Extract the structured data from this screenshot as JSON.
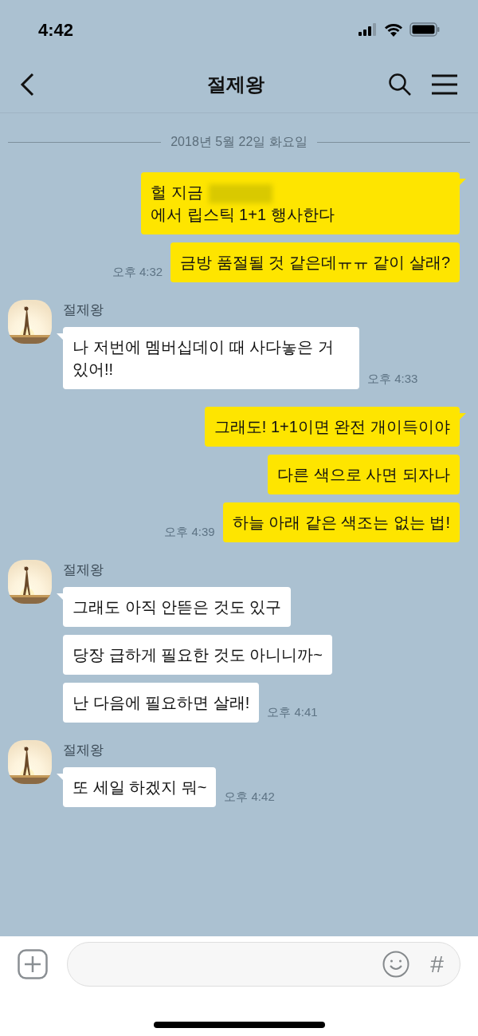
{
  "status_bar": {
    "time": "4:42"
  },
  "header": {
    "title": "절제왕"
  },
  "date_divider": "2018년 5월 22일 화요일",
  "groups": [
    {
      "kind": "sent",
      "time": "오후 4:32",
      "messages": [
        {
          "segments": [
            {
              "kind": "text",
              "text": "헐 지금"
            },
            {
              "kind": "redacted"
            },
            {
              "kind": "text",
              "text": "에서 립스틱 1+1"
            },
            {
              "kind": "text",
              "text": "행사한다"
            }
          ]
        },
        {
          "segments": [
            {
              "kind": "text",
              "text": "금방 품절될 것 같은데ㅠㅠ 같이 살래?"
            }
          ]
        }
      ]
    },
    {
      "kind": "received",
      "sender": "절제왕",
      "time": "오후 4:33",
      "messages": [
        {
          "segments": [
            {
              "kind": "text",
              "text": "나 저번에 멤버십데이 때 사다놓은 거 있어!!"
            }
          ]
        }
      ]
    },
    {
      "kind": "sent",
      "time": "오후 4:39",
      "messages": [
        {
          "segments": [
            {
              "kind": "text",
              "text": "그래도! 1+1이면 완전 개이득이야"
            }
          ]
        },
        {
          "segments": [
            {
              "kind": "text",
              "text": "다른 색으로 사면 되자나"
            }
          ]
        },
        {
          "segments": [
            {
              "kind": "text",
              "text": "하늘 아래 같은 색조는 없는 법!"
            }
          ]
        }
      ]
    },
    {
      "kind": "received",
      "sender": "절제왕",
      "time": "오후 4:41",
      "messages": [
        {
          "segments": [
            {
              "kind": "text",
              "text": "그래도 아직 안뜯은 것도 있구"
            }
          ]
        },
        {
          "segments": [
            {
              "kind": "text",
              "text": "당장 급하게 필요한 것도 아니니까~"
            }
          ]
        },
        {
          "segments": [
            {
              "kind": "text",
              "text": "난 다음에 필요하면 살래!"
            }
          ]
        }
      ]
    },
    {
      "kind": "received",
      "sender": "절제왕",
      "time": "오후 4:42",
      "messages": [
        {
          "segments": [
            {
              "kind": "text",
              "text": "또 세일 하겠지 뭐~"
            }
          ]
        }
      ]
    }
  ],
  "composer": {
    "hashtag": "#"
  }
}
